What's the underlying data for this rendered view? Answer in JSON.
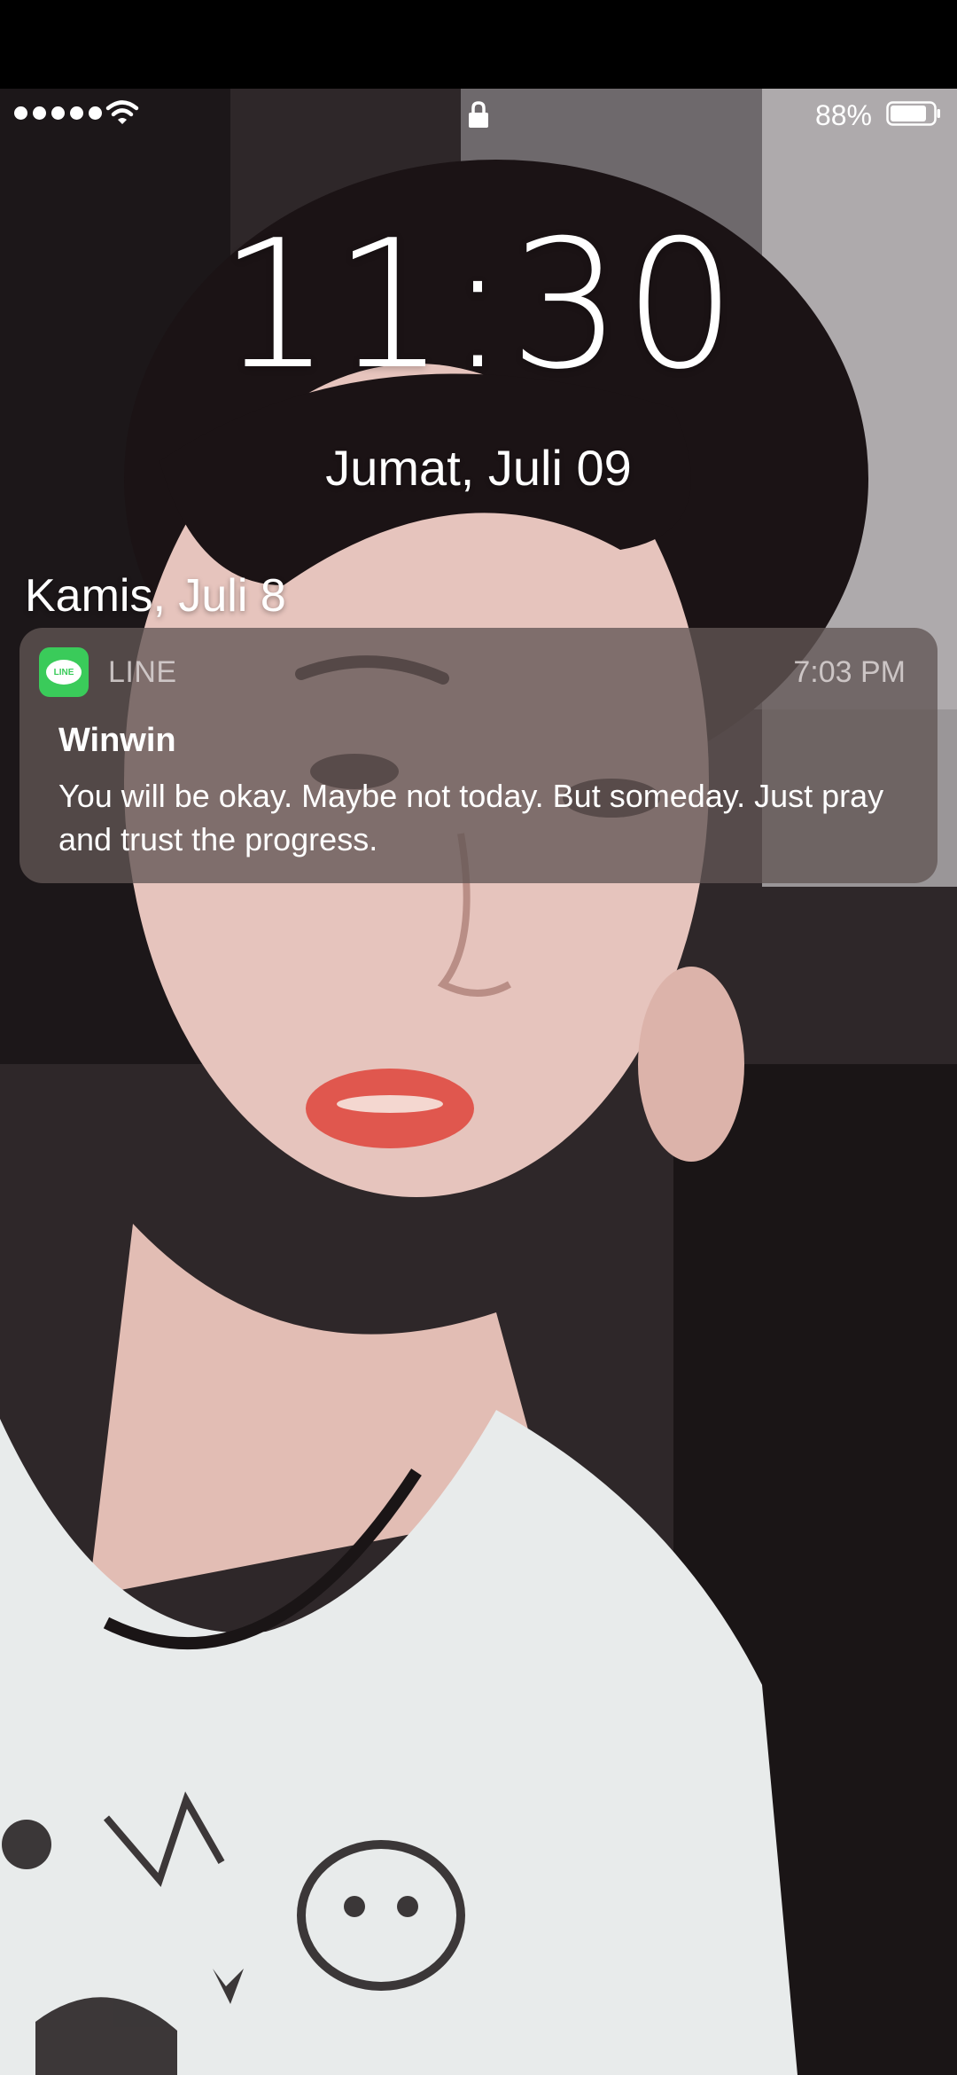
{
  "status_bar": {
    "signal_icon": "signal-dots-icon",
    "wifi_icon": "wifi-icon",
    "lock_icon": "lock-icon",
    "battery_percent": "88%",
    "battery_level": 0.88
  },
  "lock_screen": {
    "time": "11:30",
    "date": "Jumat, Juli 09",
    "section_header": "Kamis, Juli 8"
  },
  "notification": {
    "app_name": "LINE",
    "app_icon_label": "LINE",
    "app_icon_color": "#3ACB5A",
    "time": "7:03 PM",
    "sender": "Winwin",
    "message": "You will be okay. Maybe not today. But someday. Just pray and trust the progress."
  }
}
